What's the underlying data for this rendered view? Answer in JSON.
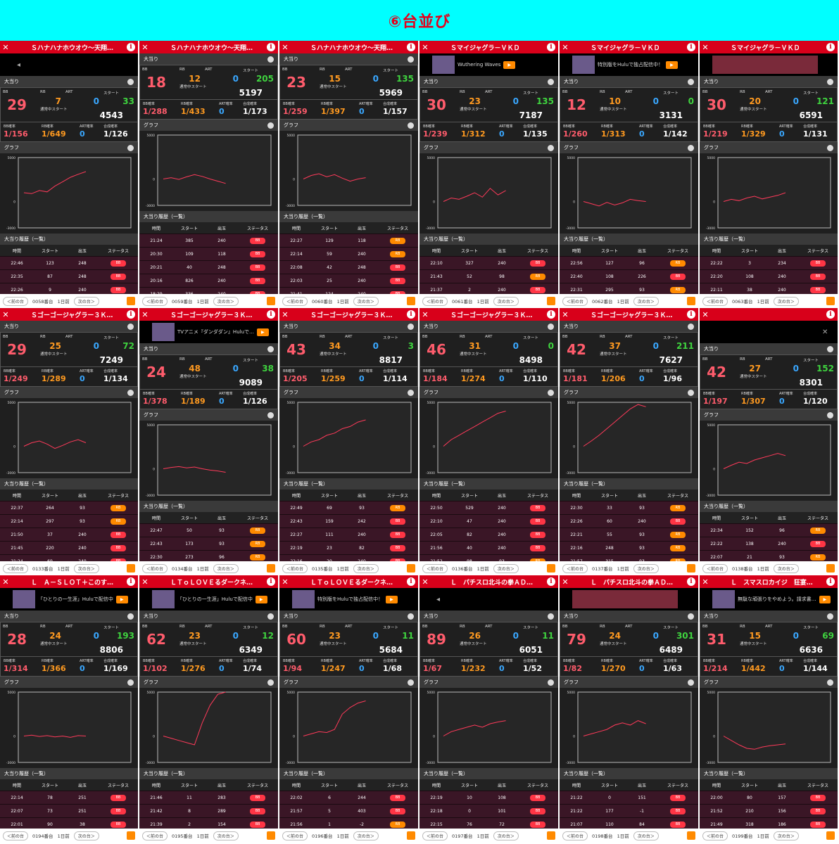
{
  "banner": {
    "title": "⑥台並び"
  },
  "labels": {
    "big_hits": "大当り",
    "graph": "グラフ",
    "history": "大当り履歴（一覧）",
    "bb": "BB",
    "rb": "RB",
    "art": "ART",
    "start": "スタート",
    "normal_start": "通常中スタート",
    "bb_prob": "BB確率",
    "rb_prob": "RB確率",
    "art_prob": "ART確率",
    "total_prob": "合成確率",
    "col_time": "時間",
    "col_start": "スタート",
    "col_payout": "出玉",
    "col_status": "ステータス",
    "prev": "＜前の台",
    "next": "次の台＞",
    "days_ago": "1日前",
    "y_top": "5000",
    "y_zero": "0",
    "y_bottom": "-3000"
  },
  "machines": [
    {
      "name": "Ｓハナハナホウオウ～天翔…",
      "bb": "29",
      "rb": "7",
      "art": "0",
      "start": "33",
      "total": "4543",
      "p_bb": "1/156",
      "p_rb": "1/649",
      "p_art": "0",
      "p_total": "1/126",
      "footer": "0058番台",
      "ad": "video",
      "curve": [
        0.2,
        0.18,
        0.25,
        0.22,
        0.35,
        0.45,
        0.55,
        0.62,
        0.68
      ],
      "history": [
        [
          "22:46",
          "123",
          "248",
          "BB"
        ],
        [
          "22:35",
          "87",
          "248",
          "BB"
        ],
        [
          "22:26",
          "9",
          "240",
          "BB"
        ],
        [
          "22:23",
          "118",
          "240",
          "BB"
        ]
      ]
    },
    {
      "name": "Ｓハナハナホウオウ～天翔…",
      "bb": "18",
      "rb": "12",
      "art": "0",
      "start": "205",
      "total": "5197",
      "p_bb": "1/288",
      "p_rb": "1/433",
      "p_art": "0",
      "p_total": "1/173",
      "footer": "0059番台",
      "ad": "none",
      "curve": [
        0.0,
        0.03,
        -0.01,
        0.05,
        0.1,
        0.06,
        0.0,
        -0.05,
        -0.1
      ],
      "history": [
        [
          "21:24",
          "385",
          "240",
          "BB"
        ],
        [
          "20:30",
          "109",
          "118",
          "BB"
        ],
        [
          "20:21",
          "40",
          "248",
          "BB"
        ],
        [
          "20:16",
          "826",
          "240",
          "BB"
        ],
        [
          "18:29",
          "336",
          "240",
          "BB"
        ]
      ]
    },
    {
      "name": "Ｓハナハナホウオウ～天翔…",
      "bb": "23",
      "rb": "15",
      "art": "0",
      "start": "135",
      "total": "5969",
      "p_bb": "1/259",
      "p_rb": "1/397",
      "p_art": "0",
      "p_total": "1/157",
      "footer": "0060番台",
      "ad": "none",
      "curve": [
        0.0,
        0.08,
        0.12,
        0.05,
        0.1,
        0.02,
        -0.05,
        0.0,
        0.03
      ],
      "history": [
        [
          "22:27",
          "129",
          "118",
          "RB"
        ],
        [
          "22:14",
          "59",
          "240",
          "RB"
        ],
        [
          "22:08",
          "42",
          "248",
          "BB"
        ],
        [
          "22:03",
          "25",
          "240",
          "BB"
        ],
        [
          "21:41",
          "124",
          "240",
          "BB"
        ]
      ]
    },
    {
      "name": "Ｓマイジャグラ－ＶＫＤ",
      "bb": "30",
      "rb": "23",
      "art": "0",
      "start": "135",
      "total": "7187",
      "p_bb": "1/239",
      "p_rb": "1/312",
      "p_art": "0",
      "p_total": "1/135",
      "footer": "0061番台",
      "ad": "Wuthering Waves",
      "curve": [
        0.0,
        0.08,
        0.05,
        0.12,
        0.2,
        0.1,
        0.3,
        0.15,
        0.25
      ],
      "history": [
        [
          "22:10",
          "327",
          "240",
          "BB"
        ],
        [
          "21:43",
          "52",
          "98",
          "RB"
        ],
        [
          "21:37",
          "2",
          "240",
          "BB"
        ],
        [
          "21:29",
          "42",
          "96",
          "RB"
        ]
      ]
    },
    {
      "name": "Ｓマイジャグラ－ＶＫＤ",
      "bb": "12",
      "rb": "10",
      "art": "0",
      "start": "0",
      "total": "3131",
      "p_bb": "1/260",
      "p_rb": "1/313",
      "p_art": "0",
      "p_total": "1/142",
      "footer": "0062番台",
      "ad": "特別版をHuluで独占配信中！",
      "curve": [
        0.0,
        -0.05,
        -0.1,
        -0.02,
        -0.08,
        -0.03,
        0.05,
        0.02,
        0.0
      ],
      "history": [
        [
          "22:56",
          "127",
          "96",
          "RB"
        ],
        [
          "22:40",
          "108",
          "226",
          "BB"
        ],
        [
          "22:31",
          "295",
          "93",
          "RB"
        ],
        [
          "22:29",
          "9",
          "237",
          "BB"
        ]
      ]
    },
    {
      "name": "Ｓマイジャグラ－ＶＫＤ",
      "bb": "30",
      "rb": "20",
      "art": "0",
      "start": "121",
      "total": "6591",
      "p_bb": "1/219",
      "p_rb": "1/329",
      "p_art": "0",
      "p_total": "1/131",
      "footer": "0063番台",
      "ad": "game",
      "curve": [
        0.0,
        0.05,
        0.02,
        0.08,
        0.12,
        0.06,
        0.1,
        0.14,
        0.2
      ],
      "history": [
        [
          "22:22",
          "3",
          "234",
          "BB"
        ],
        [
          "22:20",
          "108",
          "240",
          "BB"
        ],
        [
          "22:11",
          "38",
          "240",
          "BB"
        ]
      ]
    },
    {
      "name": "Ｓゴーゴージャグラー３Ｋ…",
      "bb": "29",
      "rb": "25",
      "art": "0",
      "start": "72",
      "total": "7249",
      "p_bb": "1/249",
      "p_rb": "1/289",
      "p_art": "0",
      "p_total": "1/134",
      "footer": "0133番台",
      "ad": "none",
      "curve": [
        0.0,
        0.08,
        0.12,
        0.05,
        -0.05,
        0.02,
        0.1,
        0.15,
        0.08
      ],
      "history": [
        [
          "22:37",
          "264",
          "93",
          "RB"
        ],
        [
          "22:14",
          "297",
          "93",
          "RB"
        ],
        [
          "21:50",
          "37",
          "240",
          "BB"
        ],
        [
          "21:45",
          "220",
          "240",
          "BB"
        ],
        [
          "21:24",
          "69",
          "240",
          "BB"
        ]
      ]
    },
    {
      "name": "Ｓゴーゴージャグラー３Ｋ…",
      "bb": "24",
      "rb": "48",
      "art": "0",
      "start": "38",
      "total": "9089",
      "p_bb": "1/378",
      "p_rb": "1/189",
      "p_art": "0",
      "p_total": "1/126",
      "footer": "0134番台",
      "ad": "TVアニメ『ダンダダン』Huluで…",
      "curve": [
        0.0,
        0.03,
        0.05,
        0.02,
        0.04,
        0.0,
        -0.03,
        -0.05,
        -0.08
      ],
      "history": [
        [
          "22:47",
          "50",
          "93",
          "RB"
        ],
        [
          "22:43",
          "173",
          "93",
          "RB"
        ],
        [
          "22:30",
          "273",
          "96",
          "RB"
        ],
        [
          "22:11",
          "87",
          "93",
          "RB"
        ]
      ]
    },
    {
      "name": "Ｓゴーゴージャグラー３Ｋ…",
      "bb": "43",
      "rb": "34",
      "art": "0",
      "start": "3",
      "total": "8817",
      "p_bb": "1/205",
      "p_rb": "1/259",
      "p_art": "0",
      "p_total": "1/114",
      "footer": "0135番台",
      "ad": "none",
      "curve": [
        0.0,
        0.1,
        0.15,
        0.25,
        0.3,
        0.4,
        0.45,
        0.55,
        0.6
      ],
      "history": [
        [
          "22:49",
          "69",
          "93",
          "RB"
        ],
        [
          "22:43",
          "159",
          "242",
          "BB"
        ],
        [
          "22:27",
          "111",
          "240",
          "BB"
        ],
        [
          "22:19",
          "23",
          "82",
          "BB"
        ],
        [
          "22:16",
          "20",
          "240",
          "BB"
        ]
      ]
    },
    {
      "name": "Ｓゴーゴージャグラー３Ｋ…",
      "bb": "46",
      "rb": "31",
      "art": "0",
      "start": "0",
      "total": "8498",
      "p_bb": "1/184",
      "p_rb": "1/274",
      "p_art": "0",
      "p_total": "1/110",
      "footer": "0136番台",
      "ad": "none",
      "curve": [
        0.0,
        0.15,
        0.25,
        0.35,
        0.45,
        0.55,
        0.65,
        0.75,
        0.8
      ],
      "history": [
        [
          "22:50",
          "529",
          "240",
          "BB"
        ],
        [
          "22:10",
          "47",
          "240",
          "BB"
        ],
        [
          "22:05",
          "82",
          "240",
          "BB"
        ],
        [
          "21:56",
          "40",
          "240",
          "BB"
        ],
        [
          "21:52",
          "98",
          "93",
          "RB"
        ]
      ]
    },
    {
      "name": "Ｓゴーゴージャグラー３Ｋ…",
      "bb": "42",
      "rb": "37",
      "art": "0",
      "start": "211",
      "total": "7627",
      "p_bb": "1/181",
      "p_rb": "1/206",
      "p_art": "0",
      "p_total": "1/96",
      "footer": "0137番台",
      "ad": "none",
      "curve": [
        0.0,
        0.12,
        0.25,
        0.4,
        0.55,
        0.7,
        0.85,
        0.95,
        0.9
      ],
      "history": [
        [
          "22:30",
          "33",
          "93",
          "RB"
        ],
        [
          "22:26",
          "60",
          "240",
          "BB"
        ],
        [
          "22:21",
          "55",
          "93",
          "RB"
        ],
        [
          "22:16",
          "248",
          "93",
          "RB"
        ],
        [
          "21:57",
          "315",
          "93",
          "RB"
        ]
      ]
    },
    {
      "name": "",
      "bb": "42",
      "rb": "27",
      "art": "0",
      "start": "152",
      "total": "8301",
      "p_bb": "1/197",
      "p_rb": "1/307",
      "p_art": "0",
      "p_total": "1/120",
      "footer": "0138番台",
      "ad": "close",
      "curve": [
        0.0,
        0.08,
        0.15,
        0.12,
        0.2,
        0.25,
        0.3,
        0.35,
        0.3
      ],
      "history": [
        [
          "22:34",
          "152",
          "96",
          "RB"
        ],
        [
          "22:22",
          "138",
          "240",
          "BB"
        ],
        [
          "22:07",
          "21",
          "93",
          "RB"
        ]
      ]
    },
    {
      "name": "Ｌ　Ａ－ＳＬＯＴ＋このす…",
      "bb": "28",
      "rb": "24",
      "art": "0",
      "start": "193",
      "total": "8806",
      "p_bb": "1/314",
      "p_rb": "1/366",
      "p_art": "0",
      "p_total": "1/169",
      "footer": "0194番台",
      "ad": "「ひとりの一生涯」Huluで配信中",
      "curve": [
        0.0,
        0.02,
        -0.01,
        0.01,
        -0.02,
        0.0,
        -0.03,
        0.01,
        0.0
      ],
      "history": [
        [
          "22:14",
          "78",
          "251",
          "BB"
        ],
        [
          "22:07",
          "73",
          "251",
          "BB"
        ],
        [
          "22:01",
          "90",
          "38",
          "BB"
        ],
        [
          "21:59",
          "8",
          "251",
          "BB"
        ]
      ]
    },
    {
      "name": "ＬＴｏＬＯＶＥるダークネ…",
      "bb": "62",
      "rb": "23",
      "art": "0",
      "start": "12",
      "total": "6349",
      "p_bb": "1/102",
      "p_rb": "1/276",
      "p_art": "0",
      "p_total": "1/74",
      "footer": "0195番台",
      "ad": "「ひとりの一生涯」Huluで配信中",
      "curve": [
        0.0,
        -0.05,
        -0.1,
        -0.15,
        -0.2,
        0.3,
        0.7,
        0.95,
        1.0
      ],
      "history": [
        [
          "21:46",
          "11",
          "283",
          "BB"
        ],
        [
          "21:42",
          "8",
          "289",
          "BB"
        ],
        [
          "21:39",
          "2",
          "154",
          "BB"
        ],
        [
          "21:37",
          "26",
          "279",
          "BB"
        ]
      ]
    },
    {
      "name": "ＬＴｏＬＯＶＥるダークネ…",
      "bb": "60",
      "rb": "23",
      "art": "0",
      "start": "11",
      "total": "5684",
      "p_bb": "1/94",
      "p_rb": "1/247",
      "p_art": "0",
      "p_total": "1/68",
      "footer": "0196番台",
      "ad": "特別版をHuluで独占配信中！",
      "curve": [
        0.0,
        0.05,
        0.1,
        0.08,
        0.15,
        0.5,
        0.65,
        0.75,
        0.8
      ],
      "history": [
        [
          "22:02",
          "6",
          "244",
          "BB"
        ],
        [
          "21:57",
          "5",
          "403",
          "BB"
        ],
        [
          "21:56",
          "1",
          "-2",
          "RB"
        ],
        [
          "21:55",
          "290",
          "58",
          "BB"
        ]
      ]
    },
    {
      "name": "Ｌ　パチスロ北斗の拳ＡＤ…",
      "bb": "89",
      "rb": "26",
      "art": "0",
      "start": "11",
      "total": "6051",
      "p_bb": "1/67",
      "p_rb": "1/232",
      "p_art": "0",
      "p_total": "1/52",
      "footer": "0197番台",
      "ad": "video",
      "curve": [
        0.0,
        0.1,
        0.15,
        0.2,
        0.25,
        0.2,
        0.28,
        0.32,
        0.35
      ],
      "history": [
        [
          "22:19",
          "10",
          "108",
          "BB"
        ],
        [
          "22:18",
          "0",
          "101",
          "BB"
        ],
        [
          "22:15",
          "76",
          "72",
          "BB"
        ],
        [
          "21:53",
          "11",
          "93",
          "BB"
        ]
      ]
    },
    {
      "name": "Ｌ　パチスロ北斗の拳ＡＤ…",
      "bb": "79",
      "rb": "24",
      "art": "0",
      "start": "301",
      "total": "6489",
      "p_bb": "1/82",
      "p_rb": "1/270",
      "p_art": "0",
      "p_total": "1/63",
      "footer": "0198番台",
      "ad": "game",
      "curve": [
        0.0,
        0.05,
        0.1,
        0.15,
        0.25,
        0.3,
        0.25,
        0.35,
        0.28
      ],
      "history": [
        [
          "21:22",
          "0",
          "151",
          "BB"
        ],
        [
          "21:22",
          "177",
          "-1",
          "BB"
        ],
        [
          "21:07",
          "110",
          "84",
          "BB"
        ],
        [
          "21:06",
          "85",
          "145",
          "BB"
        ]
      ]
    },
    {
      "name": "Ｌ　スマスロカイジ　狂宴…",
      "bb": "31",
      "rb": "15",
      "art": "0",
      "start": "69",
      "total": "6636",
      "p_bb": "1/214",
      "p_rb": "1/442",
      "p_art": "0",
      "p_total": "1/144",
      "footer": "0199番台",
      "ad": "無駄な頑張りをやめよう。請求書…",
      "curve": [
        0.0,
        -0.1,
        -0.2,
        -0.28,
        -0.3,
        -0.25,
        -0.22,
        -0.2,
        -0.18
      ],
      "history": [
        [
          "22:00",
          "80",
          "157",
          "BB"
        ],
        [
          "21:52",
          "210",
          "156",
          "BB"
        ],
        [
          "21:49",
          "318",
          "186",
          "BB"
        ],
        [
          "21:42",
          "117",
          "89",
          "BB"
        ]
      ]
    }
  ]
}
